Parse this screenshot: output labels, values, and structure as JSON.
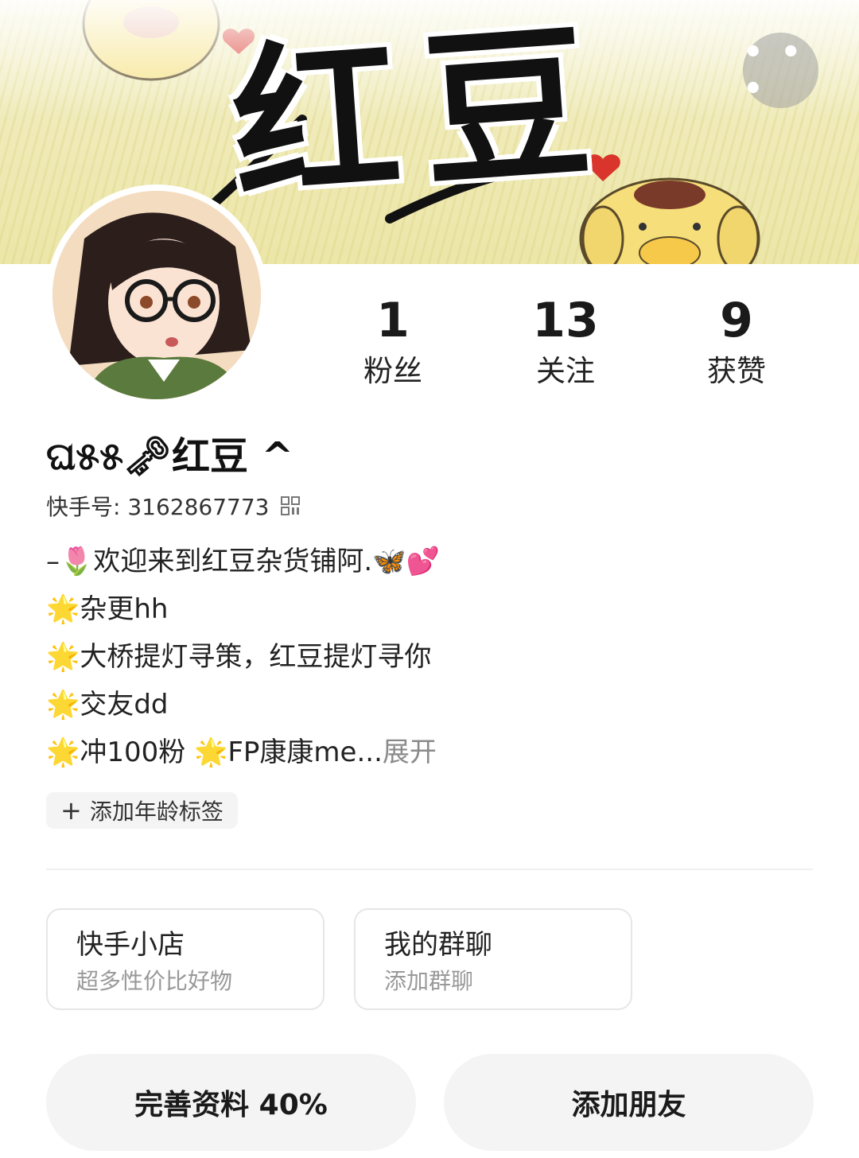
{
  "banner": {
    "title": "红豆"
  },
  "header": {
    "more_icon": "more-dots-icon",
    "more_label": "• • •"
  },
  "stats": [
    {
      "value": "1",
      "label": "粉丝"
    },
    {
      "value": "13",
      "label": "关注"
    },
    {
      "value": "9",
      "label": "获赞"
    }
  ],
  "profile": {
    "nickname": "ଘ୫୫🗝红豆 ^",
    "kuaishou_id": "快手号: 3162867773",
    "qr_icon": "qr-code-icon",
    "bio_lines": [
      "–🌷欢迎来到红豆杂货铺阿.🦋💕",
      "🌟杂更hh",
      "🌟大桥提灯寻策，红豆提灯寻你",
      "🌟交友dd",
      "🌟冲100粉 🌟FP康康me..."
    ],
    "expand_label": "展开",
    "age_tag_plus": "+",
    "age_tag_label": "添加年龄标签"
  },
  "cards": [
    {
      "title": "快手小店",
      "subtitle": "超多性价比好物"
    },
    {
      "title": "我的群聊",
      "subtitle": "添加群聊"
    }
  ],
  "actions": {
    "complete_profile": "完善资料 40%",
    "add_friend": "添加朋友"
  },
  "colors": {
    "banner_bg": "#efeab6",
    "heart": "#d9352c",
    "pompompurin": "#f6de7a"
  }
}
